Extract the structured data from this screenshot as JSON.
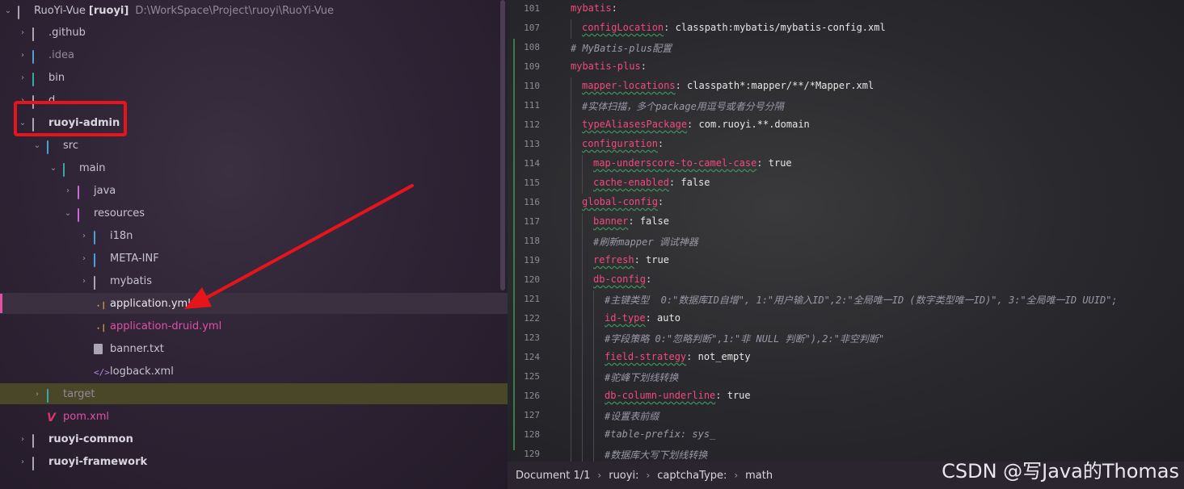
{
  "tree": {
    "root": {
      "name": "RuoYi-Vue",
      "module": "[ruoyi]",
      "path": "D:\\WorkSpace\\Project\\ruoyi\\RuoYi-Vue"
    },
    "items": [
      {
        "label": ".github"
      },
      {
        "label": ".idea"
      },
      {
        "label": "bin"
      },
      {
        "label": "d"
      },
      {
        "label": "ruoyi-admin"
      },
      {
        "label": "src"
      },
      {
        "label": "main"
      },
      {
        "label": "java"
      },
      {
        "label": "resources"
      },
      {
        "label": "i18n"
      },
      {
        "label": "META-INF"
      },
      {
        "label": "mybatis"
      },
      {
        "label": "application.yml"
      },
      {
        "label": "application-druid.yml"
      },
      {
        "label": "banner.txt"
      },
      {
        "label": "logback.xml"
      },
      {
        "label": "target"
      },
      {
        "label": "pom.xml"
      },
      {
        "label": "ruoyi-common"
      },
      {
        "label": "ruoyi-framework"
      }
    ]
  },
  "editor": {
    "line_numbers": [
      "101",
      "107",
      "108",
      "109",
      "110",
      "111",
      "112",
      "113",
      "114",
      "115",
      "116",
      "117",
      "118",
      "119",
      "120",
      "121",
      "122",
      "123",
      "124",
      "125",
      "126",
      "127",
      "128",
      "129"
    ],
    "lines": [
      {
        "k": "mybatis",
        "sep": ":",
        "v": ""
      },
      {
        "k": "configLocation",
        "sep": ": ",
        "v": "classpath:mybatis/mybatis-config.xml"
      },
      {
        "c": "# MyBatis-plus配置"
      },
      {
        "k": "mybatis-plus",
        "sep": ":",
        "v": ""
      },
      {
        "k": "mapper-locations",
        "sep": ": ",
        "v": "classpath*:mapper/**/*Mapper.xml"
      },
      {
        "c": "#实体扫描，多个package用逗号或者分号分隔"
      },
      {
        "k": "typeAliasesPackage",
        "sep": ": ",
        "v": "com.ruoyi.**.domain"
      },
      {
        "k": "configuration",
        "sep": ":",
        "v": ""
      },
      {
        "k": "map-underscore-to-camel-case",
        "sep": ": ",
        "v": "true"
      },
      {
        "k": "cache-enabled",
        "sep": ": ",
        "v": "false"
      },
      {
        "k": "global-config",
        "sep": ":",
        "v": ""
      },
      {
        "k": "banner",
        "sep": ": ",
        "v": "false"
      },
      {
        "c": "#刷新mapper 调试神器"
      },
      {
        "k": "refresh",
        "sep": ": ",
        "v": "true"
      },
      {
        "k": "db-config",
        "sep": ":",
        "v": ""
      },
      {
        "c": "#主键类型  0:\"数据库ID自增\", 1:\"用户输入ID\",2:\"全局唯一ID (数字类型唯一ID)\", 3:\"全局唯一ID UUID\";"
      },
      {
        "k": "id-type",
        "sep": ": ",
        "v": "auto"
      },
      {
        "c": "#字段策略 0:\"忽略判断\",1:\"非 NULL 判断\"),2:\"非空判断\""
      },
      {
        "k": "field-strategy",
        "sep": ": ",
        "v": "not_empty"
      },
      {
        "c": "#驼峰下划线转换"
      },
      {
        "k": "db-column-underline",
        "sep": ": ",
        "v": "true"
      },
      {
        "c": "#设置表前缀"
      },
      {
        "c": "#table-prefix: sys_"
      },
      {
        "c": "#数据库大写下划线转换"
      }
    ]
  },
  "breadcrumb": [
    "Document 1/1",
    "ruoyi:",
    "captchaType:",
    "math"
  ],
  "watermark": "CSDN @写Java的Thomas",
  "colors": {
    "highlight_box": "#e8141c",
    "arrow": "#e8141c",
    "key": "#f24a7c",
    "selected_marker": "#e24fa6"
  }
}
